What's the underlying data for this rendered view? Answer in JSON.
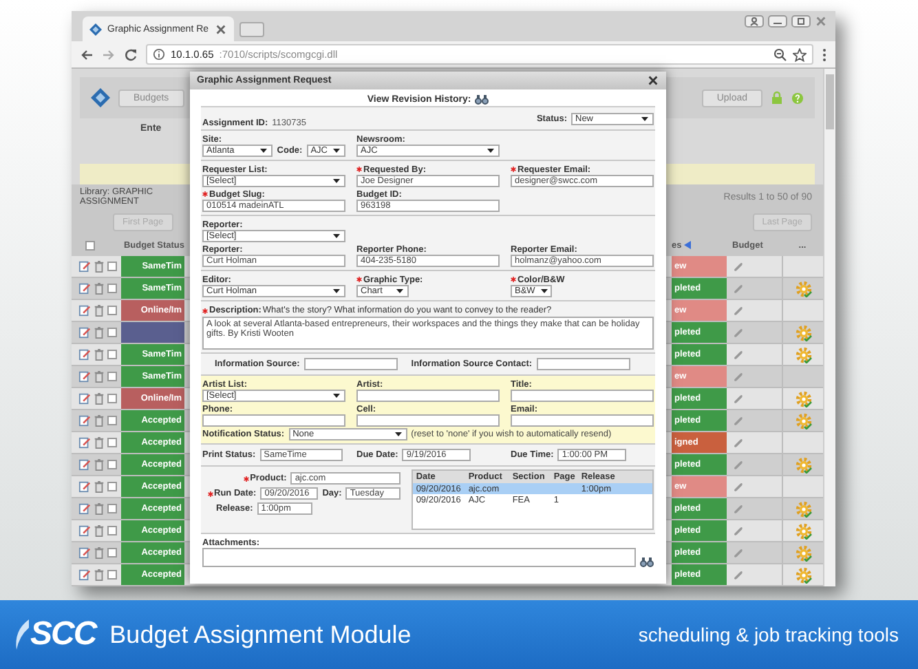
{
  "browser": {
    "tab_title": "Graphic Assignment Re",
    "url_host": "10.1.0.65",
    "url_path": ":7010/scripts/scomgcgi.dll"
  },
  "app": {
    "buttons": [
      "Budgets",
      "Upload"
    ],
    "header_text": "Ente",
    "library_label": "Library: GRAPHIC ASSIGNMENT",
    "results": "Results 1 to 50 of 90",
    "first_page": "First Page",
    "last_page": "Last Page",
    "columns": [
      "Budget Status",
      "es",
      "Budget",
      "..."
    ],
    "select_all_checked": false,
    "rows": [
      {
        "checked": false,
        "left": {
          "text": "SameTim",
          "color": "#3f9a48"
        },
        "right": {
          "text": "ew",
          "color": "#e08a85"
        },
        "gear": false
      },
      {
        "checked": false,
        "left": {
          "text": "SameTim",
          "color": "#3f9a48"
        },
        "right": {
          "text": "pleted",
          "color": "#3f9a48"
        },
        "gear": true
      },
      {
        "checked": false,
        "left": {
          "text": "Online/Im",
          "color": "#b85f5f"
        },
        "right": {
          "text": "ew",
          "color": "#e08a85"
        },
        "gear": false
      },
      {
        "checked": false,
        "left": {
          "color": "#5a5f8f"
        },
        "right": {
          "text": "pleted",
          "color": "#3f9a48"
        },
        "gear": true
      },
      {
        "checked": false,
        "left": {
          "text": "SameTim",
          "color": "#3f9a48"
        },
        "right": {
          "text": "pleted",
          "color": "#3f9a48"
        },
        "gear": true
      },
      {
        "checked": false,
        "left": {
          "text": "SameTim",
          "color": "#3f9a48"
        },
        "right": {
          "text": "ew",
          "color": "#e08a85"
        },
        "gear": false
      },
      {
        "checked": false,
        "left": {
          "text": "Online/Im",
          "color": "#b85f5f"
        },
        "right": {
          "text": "pleted",
          "color": "#3f9a48"
        },
        "gear": true
      },
      {
        "checked": false,
        "left": {
          "text": "Accepted",
          "color": "#3f9a48"
        },
        "right": {
          "text": "pleted",
          "color": "#3f9a48"
        },
        "gear": true
      },
      {
        "checked": false,
        "left": {
          "text": "Accepted",
          "color": "#3f9a48"
        },
        "right": {
          "text": "igned",
          "color": "#c9603e"
        },
        "gear": false
      },
      {
        "checked": false,
        "left": {
          "text": "Accepted",
          "color": "#3f9a48"
        },
        "right": {
          "text": "pleted",
          "color": "#3f9a48"
        },
        "gear": true
      },
      {
        "checked": false,
        "left": {
          "text": "Accepted",
          "color": "#3f9a48"
        },
        "right": {
          "text": "ew",
          "color": "#e08a85"
        },
        "gear": false
      },
      {
        "checked": false,
        "left": {
          "text": "Accepted",
          "color": "#3f9a48"
        },
        "right": {
          "text": "pleted",
          "color": "#3f9a48"
        },
        "gear": true
      },
      {
        "checked": false,
        "left": {
          "text": "Accepted",
          "color": "#3f9a48"
        },
        "right": {
          "text": "pleted",
          "color": "#3f9a48"
        },
        "gear": true
      },
      {
        "checked": false,
        "left": {
          "text": "Accepted",
          "color": "#3f9a48"
        },
        "right": {
          "text": "pleted",
          "color": "#3f9a48"
        },
        "gear": true
      },
      {
        "checked": false,
        "left": {
          "text": "Accepted",
          "color": "#3f9a48"
        },
        "right": {
          "text": "pleted",
          "color": "#3f9a48"
        },
        "gear": true
      }
    ]
  },
  "modal": {
    "title": "Graphic Assignment Request",
    "revision_label": "View Revision History:",
    "assignment_id": {
      "label": "Assignment ID:",
      "value": "1130735"
    },
    "status": {
      "label": "Status:",
      "value": "New"
    },
    "site": {
      "label": "Site:",
      "value": "Atlanta"
    },
    "code": {
      "label": "Code:",
      "value": "AJC"
    },
    "newsroom": {
      "label": "Newsroom:",
      "value": "AJC"
    },
    "requester_list": {
      "label": "Requester List:",
      "value": "[Select]"
    },
    "requested_by": {
      "label": "Requested By:",
      "value": "Joe Designer",
      "required": true
    },
    "requester_email": {
      "label": "Requester Email:",
      "value": "designer@swcc.com",
      "required": true
    },
    "budget_slug": {
      "label": "Budget Slug:",
      "value": "010514 madeinATL",
      "required": true
    },
    "budget_id": {
      "label": "Budget ID:",
      "value": "963198"
    },
    "reporter_list": {
      "label": "Reporter:",
      "value": "[Select]"
    },
    "reporter": {
      "label": "Reporter:",
      "value": "Curt Holman"
    },
    "reporter_phone": {
      "label": "Reporter Phone:",
      "value": "404-235-5180"
    },
    "reporter_email": {
      "label": "Reporter Email:",
      "value": "holmanz@yahoo.com"
    },
    "editor": {
      "label": "Editor:",
      "value": "Curt Holman"
    },
    "graphic_type": {
      "label": "Graphic Type:",
      "value": "Chart",
      "required": true
    },
    "color_bw": {
      "label": "Color/B&W",
      "value": "B&W",
      "required": true
    },
    "description": {
      "label": "Description:",
      "prompt": "What's the story? What information do you want to convey to the reader?",
      "value": "A look at several Atlanta-based entrepreneurs, their workspaces and the things they make that can be holiday gifts. By Kristi Wooten",
      "required": true
    },
    "info_source": {
      "label": "Information Source:"
    },
    "info_contact": {
      "label": "Information Source Contact:"
    },
    "artist_list": {
      "label": "Artist List:",
      "value": "[Select]"
    },
    "artist": {
      "label": "Artist:"
    },
    "artist_title": {
      "label": "Title:"
    },
    "phone": {
      "label": "Phone:"
    },
    "cell": {
      "label": "Cell:"
    },
    "email": {
      "label": "Email:"
    },
    "notification": {
      "label": "Notification Status:",
      "value": "None",
      "note": "(reset to 'none' if you wish to automatically resend)"
    },
    "print_status": {
      "label": "Print Status:",
      "value": "SameTime"
    },
    "due_date": {
      "label": "Due Date:",
      "value": "9/19/2016"
    },
    "due_time": {
      "label": "Due Time:",
      "value": "1:00:00 PM"
    },
    "product": {
      "label": "Product:",
      "value": "ajc.com",
      "required": true
    },
    "run_date": {
      "label": "Run Date:",
      "value": "09/20/2016",
      "required": true
    },
    "day": {
      "label": "Day:",
      "value": "Tuesday"
    },
    "release": {
      "label": "Release:",
      "value": "1:00pm"
    },
    "runs": {
      "columns": [
        "Date",
        "Product",
        "Section",
        "Page",
        "Release"
      ],
      "rows": [
        {
          "cells": [
            "09/20/2016",
            "ajc.com",
            "",
            "",
            "1:00pm"
          ],
          "selected": true
        },
        {
          "cells": [
            "09/20/2016",
            "AJC",
            "FEA",
            "1",
            ""
          ],
          "selected": false
        }
      ]
    },
    "attachments": {
      "label": "Attachments:"
    }
  },
  "banner": {
    "logo": "SCC",
    "title": "Budget Assignment Module",
    "tagline": "scheduling & job tracking tools"
  }
}
